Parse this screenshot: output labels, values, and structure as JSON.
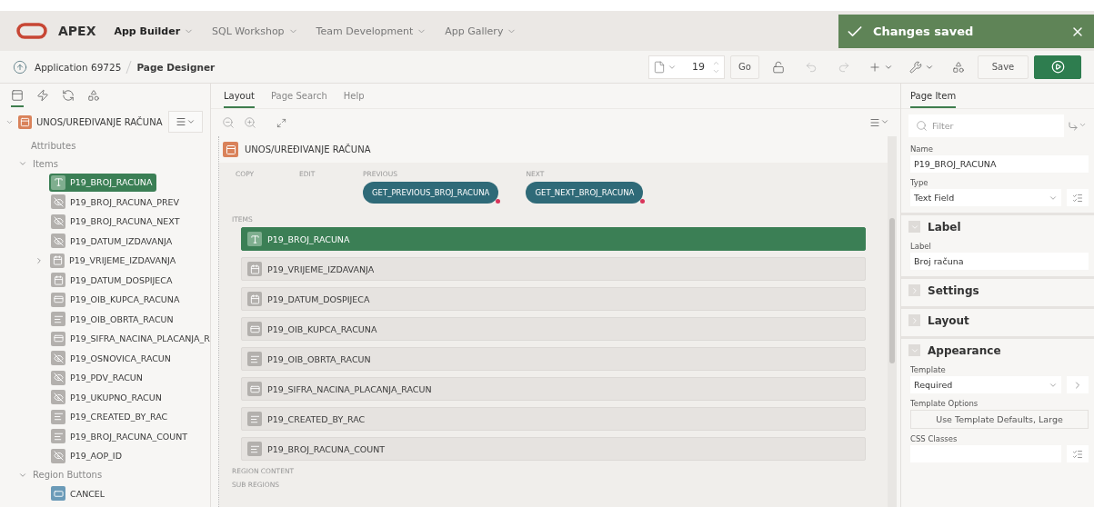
{
  "header": {
    "product": "APEX",
    "nav": [
      {
        "label": "App Builder",
        "selected": true
      },
      {
        "label": "SQL Workshop",
        "selected": false
      },
      {
        "label": "Team Development",
        "selected": false
      },
      {
        "label": "App Gallery",
        "selected": false
      }
    ],
    "toast": {
      "message": "Changes saved"
    }
  },
  "breadcrumb": {
    "parent": "Application 69725",
    "current": "Page Designer"
  },
  "toolbar": {
    "page_number": "19",
    "go": "Go",
    "save": "Save"
  },
  "left": {
    "tabs": [
      {
        "kind": "rendering",
        "selected": true
      },
      {
        "kind": "dynamic",
        "selected": false
      },
      {
        "kind": "processing",
        "selected": false
      },
      {
        "kind": "shared",
        "selected": false
      }
    ],
    "region": "UNOS/UREĐIVANJE RAČUNA",
    "tree": [
      {
        "label": "Attributes"
      },
      {
        "label": "Items",
        "expanded": true,
        "children": [
          {
            "label": "P19_BROJ_RACUNA",
            "kind": "text",
            "selected": true
          },
          {
            "label": "P19_BROJ_RACUNA_PREV",
            "kind": "hidden",
            "selected": false
          },
          {
            "label": "P19_BROJ_RACUNA_NEXT",
            "kind": "hidden",
            "selected": false
          },
          {
            "label": "P19_DATUM_IZDAVANJA",
            "kind": "hidden",
            "selected": false
          },
          {
            "label": "P19_VRIJEME_IZDAVANJA",
            "kind": "date",
            "selected": false,
            "expandable": true
          },
          {
            "label": "P19_DATUM_DOSPIJECA",
            "kind": "date",
            "selected": false
          },
          {
            "label": "P19_OIB_KUPCA_RACUNA",
            "kind": "popup",
            "selected": false
          },
          {
            "label": "P19_OIB_OBRTA_RACUN",
            "kind": "display",
            "selected": false
          },
          {
            "label": "P19_SIFRA_NACINA_PLACANJA_R",
            "kind": "popup",
            "selected": false
          },
          {
            "label": "P19_OSNOVICA_RACUN",
            "kind": "hidden",
            "selected": false
          },
          {
            "label": "P19_PDV_RACUN",
            "kind": "hidden",
            "selected": false
          },
          {
            "label": "P19_UKUPNO_RACUN",
            "kind": "hidden",
            "selected": false
          },
          {
            "label": "P19_CREATED_BY_RAC",
            "kind": "display",
            "selected": false
          },
          {
            "label": "P19_BROJ_RACUNA_COUNT",
            "kind": "display",
            "selected": false
          },
          {
            "label": "P19_AOP_ID",
            "kind": "hidden",
            "selected": false
          }
        ]
      },
      {
        "label": "Region Buttons",
        "expanded": true,
        "children": [
          {
            "label": "CANCEL",
            "kind": "button",
            "selected": false
          }
        ]
      }
    ]
  },
  "center": {
    "tabs": [
      {
        "label": "Layout",
        "selected": true
      },
      {
        "label": "Page Search",
        "selected": false
      },
      {
        "label": "Help",
        "selected": false
      }
    ],
    "region": "UNOS/UREĐIVANJE RAČUNA",
    "positions": [
      {
        "label": "COPY"
      },
      {
        "label": "EDIT"
      },
      {
        "label": "PREVIOUS",
        "button": "GET_PREVIOUS_BROJ_RACUNA"
      },
      {
        "label": "NEXT",
        "button": "GET_NEXT_BROJ_RACUNA"
      }
    ],
    "items_label": "ITEMS",
    "items": [
      {
        "label": "P19_BROJ_RACUNA",
        "kind": "text",
        "selected": true
      },
      {
        "label": "P19_VRIJEME_IZDAVANJA",
        "kind": "date",
        "selected": false
      },
      {
        "label": "P19_DATUM_DOSPIJECA",
        "kind": "date",
        "selected": false
      },
      {
        "label": "P19_OIB_KUPCA_RACUNA",
        "kind": "popup",
        "selected": false
      },
      {
        "label": "P19_OIB_OBRTA_RACUN",
        "kind": "display",
        "selected": false
      },
      {
        "label": "P19_SIFRA_NACINA_PLACANJA_RACUN",
        "kind": "popup",
        "selected": false
      },
      {
        "label": "P19_CREATED_BY_RAC",
        "kind": "display",
        "selected": false
      },
      {
        "label": "P19_BROJ_RACUNA_COUNT",
        "kind": "display",
        "selected": false
      }
    ],
    "footer_labels": [
      "REGION CONTENT",
      "SUB REGIONS"
    ]
  },
  "right": {
    "tab": "Page Item",
    "filter": {
      "placeholder": "Filter"
    },
    "props": [
      {
        "kind": "field",
        "label": "Name",
        "value": "P19_BROJ_RACUNA"
      },
      {
        "kind": "picker",
        "label": "Type",
        "value": "Text Field"
      },
      {
        "kind": "group",
        "title": "Label",
        "expanded": true
      },
      {
        "kind": "field",
        "label": "Label",
        "value": "Broj računa"
      },
      {
        "kind": "group",
        "title": "Settings",
        "expanded": false
      },
      {
        "kind": "group",
        "title": "Layout",
        "expanded": false
      },
      {
        "kind": "group",
        "title": "Appearance",
        "expanded": true
      },
      {
        "kind": "template",
        "label": "Template",
        "value": "Required"
      },
      {
        "kind": "button",
        "label": "Template Options",
        "value": "Use Template Defaults, Large"
      },
      {
        "kind": "listfield",
        "label": "CSS Classes"
      }
    ]
  }
}
